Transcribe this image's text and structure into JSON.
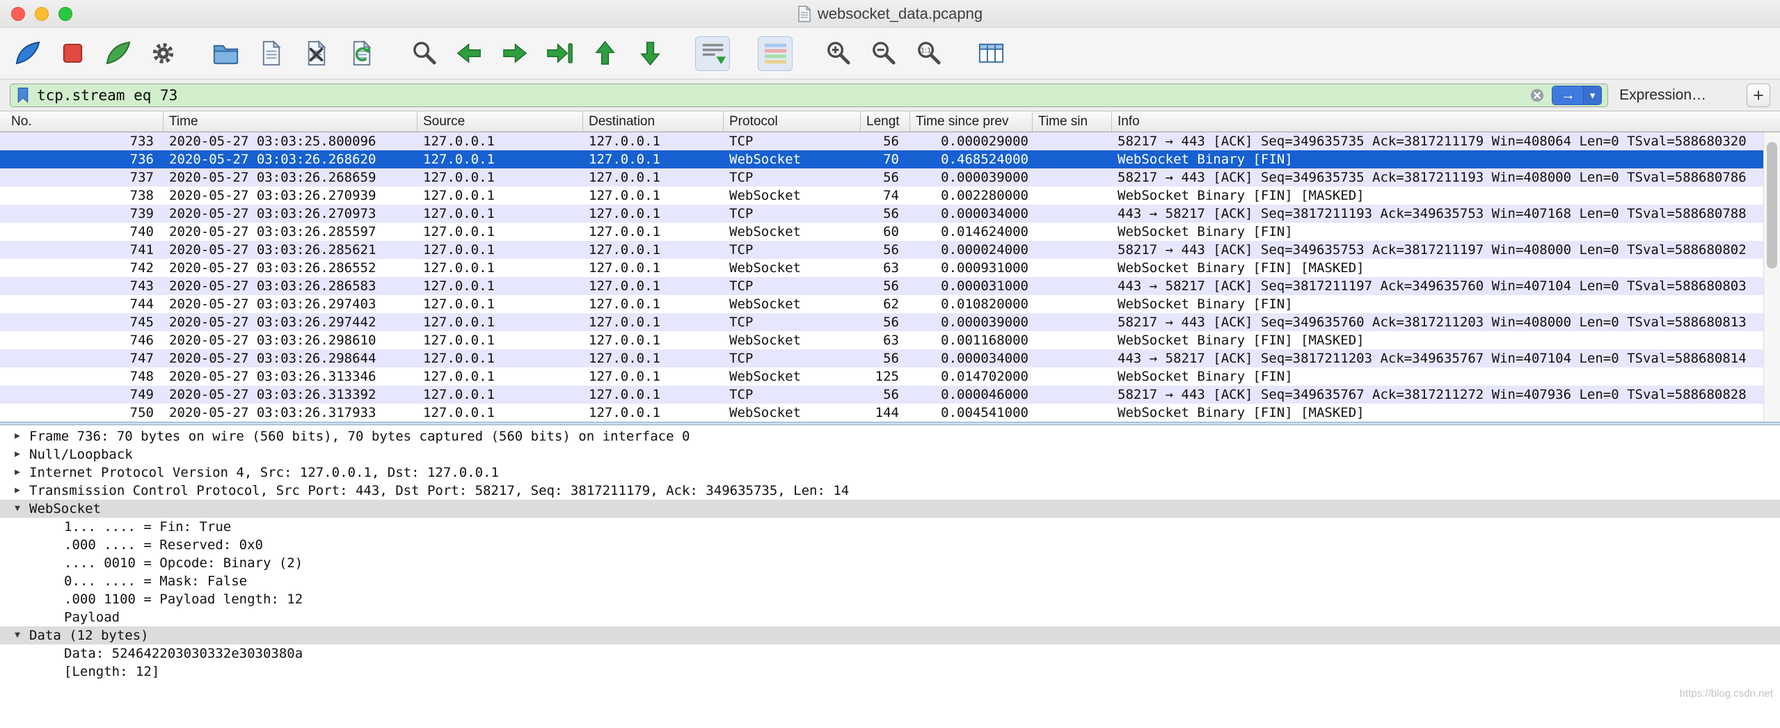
{
  "window": {
    "title": "websocket_data.pcapng"
  },
  "colors": {
    "selected_row": "#1660d2",
    "tcp_row": "#e7e6ff",
    "filter_valid_bg": "#d2eecd",
    "apply_button_blue": "#3f7ade",
    "traffic_red": "#ff5f57",
    "traffic_yellow": "#febc2e",
    "traffic_green": "#28c840"
  },
  "toolbar": {
    "groups": [
      [
        "start-capture",
        "stop-capture",
        "restart-capture",
        "capture-options"
      ],
      [
        "open-file",
        "save-file",
        "close-file",
        "reload-file"
      ],
      [
        "find-packet",
        "previous-packet",
        "next-packet",
        "goto-packet",
        "first-packet",
        "last-packet"
      ],
      [
        "auto-scroll"
      ],
      [
        "colorize"
      ],
      [
        "zoom-in",
        "zoom-out",
        "zoom-normal"
      ],
      [
        "resize-columns"
      ]
    ],
    "pressed": [
      "auto-scroll",
      "colorize"
    ]
  },
  "filter": {
    "value": "tcp.stream eq 73",
    "apply_glyph": "→",
    "caret_glyph": "▾",
    "expression_label": "Expression…",
    "add_label": "+"
  },
  "packet_list": {
    "columns": [
      "No.",
      "Time",
      "Source",
      "Destination",
      "Protocol",
      "Lengt",
      "Time since prev",
      "Time sin",
      "Info"
    ],
    "rows": [
      {
        "no": "733",
        "time": "2020-05-27 03:03:25.800096",
        "source": "127.0.0.1",
        "destination": "127.0.0.1",
        "protocol": "TCP",
        "length": "56",
        "delta": "0.000029000",
        "delta2": "",
        "info": "58217 → 443 [ACK] Seq=349635735 Ack=3817211179 Win=408064 Len=0 TSval=588680320"
      },
      {
        "no": "736",
        "time": "2020-05-27 03:03:26.268620",
        "source": "127.0.0.1",
        "destination": "127.0.0.1",
        "protocol": "WebSocket",
        "length": "70",
        "delta": "0.468524000",
        "delta2": "",
        "info": "WebSocket Binary [FIN]",
        "selected": true
      },
      {
        "no": "737",
        "time": "2020-05-27 03:03:26.268659",
        "source": "127.0.0.1",
        "destination": "127.0.0.1",
        "protocol": "TCP",
        "length": "56",
        "delta": "0.000039000",
        "delta2": "",
        "info": "58217 → 443 [ACK] Seq=349635735 Ack=3817211193 Win=408000 Len=0 TSval=588680786"
      },
      {
        "no": "738",
        "time": "2020-05-27 03:03:26.270939",
        "source": "127.0.0.1",
        "destination": "127.0.0.1",
        "protocol": "WebSocket",
        "length": "74",
        "delta": "0.002280000",
        "delta2": "",
        "info": "WebSocket Binary [FIN] [MASKED]"
      },
      {
        "no": "739",
        "time": "2020-05-27 03:03:26.270973",
        "source": "127.0.0.1",
        "destination": "127.0.0.1",
        "protocol": "TCP",
        "length": "56",
        "delta": "0.000034000",
        "delta2": "",
        "info": "443 → 58217 [ACK] Seq=3817211193 Ack=349635753 Win=407168 Len=0 TSval=588680788"
      },
      {
        "no": "740",
        "time": "2020-05-27 03:03:26.285597",
        "source": "127.0.0.1",
        "destination": "127.0.0.1",
        "protocol": "WebSocket",
        "length": "60",
        "delta": "0.014624000",
        "delta2": "",
        "info": "WebSocket Binary [FIN]"
      },
      {
        "no": "741",
        "time": "2020-05-27 03:03:26.285621",
        "source": "127.0.0.1",
        "destination": "127.0.0.1",
        "protocol": "TCP",
        "length": "56",
        "delta": "0.000024000",
        "delta2": "",
        "info": "58217 → 443 [ACK] Seq=349635753 Ack=3817211197 Win=408000 Len=0 TSval=588680802"
      },
      {
        "no": "742",
        "time": "2020-05-27 03:03:26.286552",
        "source": "127.0.0.1",
        "destination": "127.0.0.1",
        "protocol": "WebSocket",
        "length": "63",
        "delta": "0.000931000",
        "delta2": "",
        "info": "WebSocket Binary [FIN] [MASKED]"
      },
      {
        "no": "743",
        "time": "2020-05-27 03:03:26.286583",
        "source": "127.0.0.1",
        "destination": "127.0.0.1",
        "protocol": "TCP",
        "length": "56",
        "delta": "0.000031000",
        "delta2": "",
        "info": "443 → 58217 [ACK] Seq=3817211197 Ack=349635760 Win=407104 Len=0 TSval=588680803"
      },
      {
        "no": "744",
        "time": "2020-05-27 03:03:26.297403",
        "source": "127.0.0.1",
        "destination": "127.0.0.1",
        "protocol": "WebSocket",
        "length": "62",
        "delta": "0.010820000",
        "delta2": "",
        "info": "WebSocket Binary [FIN]"
      },
      {
        "no": "745",
        "time": "2020-05-27 03:03:26.297442",
        "source": "127.0.0.1",
        "destination": "127.0.0.1",
        "protocol": "TCP",
        "length": "56",
        "delta": "0.000039000",
        "delta2": "",
        "info": "58217 → 443 [ACK] Seq=349635760 Ack=3817211203 Win=408000 Len=0 TSval=588680813"
      },
      {
        "no": "746",
        "time": "2020-05-27 03:03:26.298610",
        "source": "127.0.0.1",
        "destination": "127.0.0.1",
        "protocol": "WebSocket",
        "length": "63",
        "delta": "0.001168000",
        "delta2": "",
        "info": "WebSocket Binary [FIN] [MASKED]"
      },
      {
        "no": "747",
        "time": "2020-05-27 03:03:26.298644",
        "source": "127.0.0.1",
        "destination": "127.0.0.1",
        "protocol": "TCP",
        "length": "56",
        "delta": "0.000034000",
        "delta2": "",
        "info": "443 → 58217 [ACK] Seq=3817211203 Ack=349635767 Win=407104 Len=0 TSval=588680814"
      },
      {
        "no": "748",
        "time": "2020-05-27 03:03:26.313346",
        "source": "127.0.0.1",
        "destination": "127.0.0.1",
        "protocol": "WebSocket",
        "length": "125",
        "delta": "0.014702000",
        "delta2": "",
        "info": "WebSocket Binary [FIN]"
      },
      {
        "no": "749",
        "time": "2020-05-27 03:03:26.313392",
        "source": "127.0.0.1",
        "destination": "127.0.0.1",
        "protocol": "TCP",
        "length": "56",
        "delta": "0.000046000",
        "delta2": "",
        "info": "58217 → 443 [ACK] Seq=349635767 Ack=3817211272 Win=407936 Len=0 TSval=588680828"
      },
      {
        "no": "750",
        "time": "2020-05-27 03:03:26.317933",
        "source": "127.0.0.1",
        "destination": "127.0.0.1",
        "protocol": "WebSocket",
        "length": "144",
        "delta": "0.004541000",
        "delta2": "",
        "info": "WebSocket Binary [FIN] [MASKED]"
      }
    ]
  },
  "details": {
    "rows": [
      {
        "indent": 0,
        "expand": "closed",
        "text": "Frame 736: 70 bytes on wire (560 bits), 70 bytes captured (560 bits) on interface 0"
      },
      {
        "indent": 0,
        "expand": "closed",
        "text": "Null/Loopback"
      },
      {
        "indent": 0,
        "expand": "closed",
        "text": "Internet Protocol Version 4, Src: 127.0.0.1, Dst: 127.0.0.1"
      },
      {
        "indent": 0,
        "expand": "closed",
        "text": "Transmission Control Protocol, Src Port: 443, Dst Port: 58217, Seq: 3817211179, Ack: 349635735, Len: 14"
      },
      {
        "indent": 0,
        "expand": "open",
        "text": "WebSocket",
        "hl": true
      },
      {
        "indent": 1,
        "expand": null,
        "text": "1... .... = Fin: True"
      },
      {
        "indent": 1,
        "expand": null,
        "text": ".000 .... = Reserved: 0x0"
      },
      {
        "indent": 1,
        "expand": null,
        "text": ".... 0010 = Opcode: Binary (2)"
      },
      {
        "indent": 1,
        "expand": null,
        "text": "0... .... = Mask: False"
      },
      {
        "indent": 1,
        "expand": null,
        "text": ".000 1100 = Payload length: 12"
      },
      {
        "indent": 1,
        "expand": null,
        "text": "Payload"
      },
      {
        "indent": 0,
        "expand": "open",
        "text": "Data (12 bytes)",
        "hl": true
      },
      {
        "indent": 1,
        "expand": null,
        "text": "Data: 524642203030332e3030380a"
      },
      {
        "indent": 1,
        "expand": null,
        "text": "[Length: 12]"
      }
    ]
  },
  "watermark": "https://blog.csdn.net"
}
